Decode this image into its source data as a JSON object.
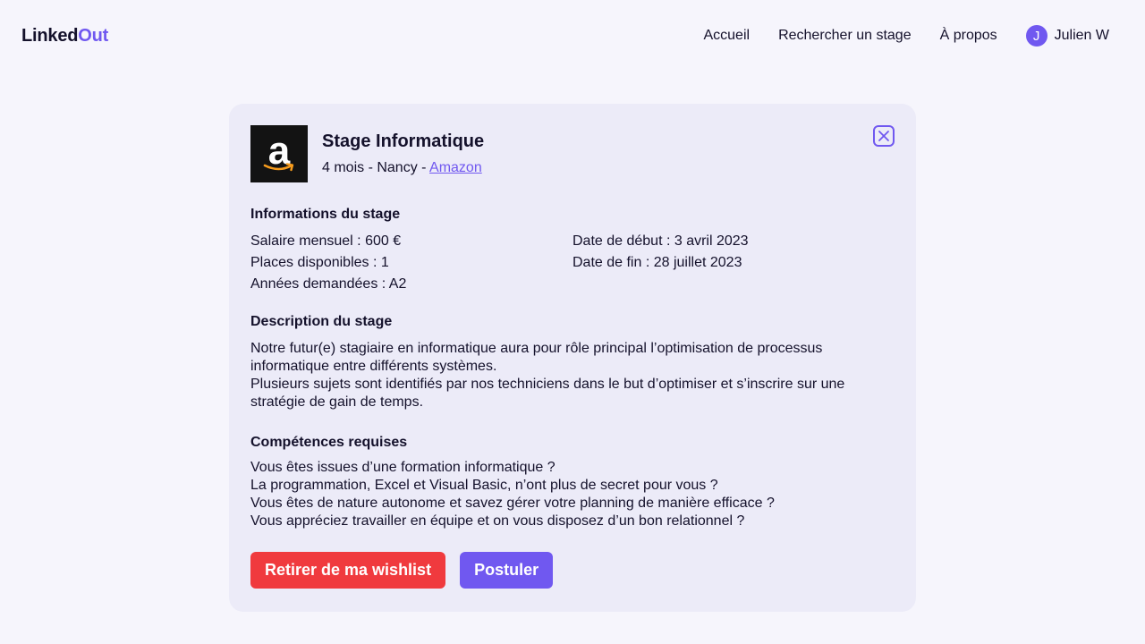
{
  "header": {
    "logo_part_a": "Linked",
    "logo_part_b": "Out",
    "nav": [
      "Accueil",
      "Rechercher un stage",
      "À propos"
    ],
    "user": {
      "initial": "J",
      "name": "Julien W"
    }
  },
  "offer": {
    "title": "Stage Informatique",
    "meta_prefix": "4 mois - Nancy - ",
    "company": "Amazon",
    "logo_letter": "a",
    "info_title": "Informations du stage",
    "info_left": [
      "Salaire mensuel : 600 €",
      "Places disponibles : 1",
      "Années demandées : A2"
    ],
    "info_right": [
      "Date de début : 3 avril 2023",
      "Date de fin : 28 juillet 2023"
    ],
    "description_title": "Description du stage",
    "description": [
      "Notre futur(e) stagiaire en informatique aura pour rôle principal l’optimisation de processus informatique entre différents systèmes.",
      "Plusieurs sujets sont identifiés par nos techniciens dans le but d’optimiser et s’inscrire sur une stratégie de gain de temps."
    ],
    "skills_title": "Compétences requises",
    "skills": [
      "Vous êtes issues d’une formation informatique ?",
      "La programmation, Excel et Visual Basic, n’ont plus de secret pour vous ?",
      "Vous êtes de nature autonome et savez gérer votre planning de manière efficace ?",
      "Vous appréciez travailler en équipe et on vous disposez d’un bon relationnel ?"
    ],
    "remove_label": "Retirer de ma wishlist",
    "apply_label": "Postuler"
  },
  "icons": {
    "close": "close-icon",
    "company_logo": "amazon-logo"
  },
  "colors": {
    "accent": "#7058f0",
    "danger": "#f03a3e",
    "background": "#f6f5fc",
    "card": "#ecebf8",
    "text": "#14112b"
  }
}
